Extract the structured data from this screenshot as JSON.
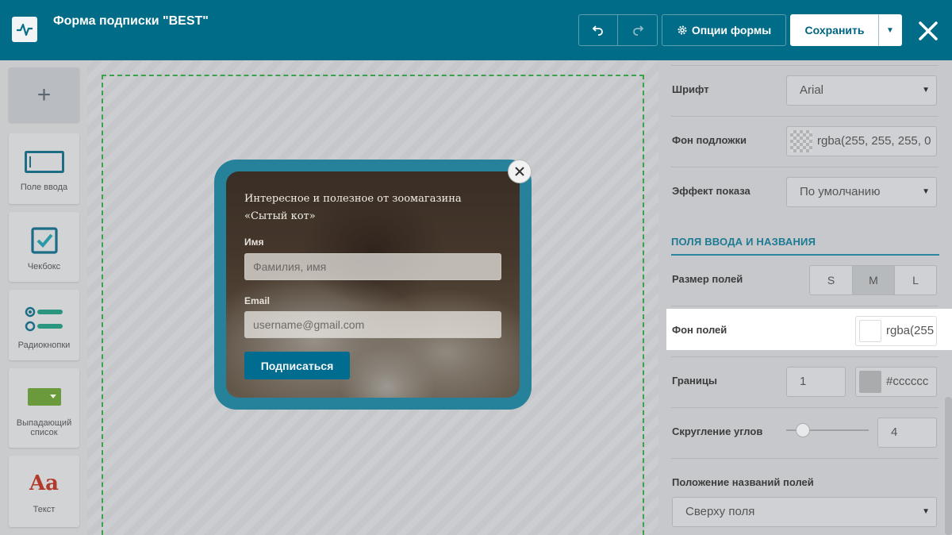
{
  "header": {
    "title": "Форма подписки \"BEST\"",
    "options_label": "Опции формы",
    "save_label": "Сохранить",
    "icons": [
      "logo-icon",
      "undo-icon",
      "redo-icon",
      "gear-icon",
      "caret-down-icon",
      "close-icon"
    ]
  },
  "toolbox": {
    "add_label": "+",
    "items": [
      {
        "label": "Поле ввода",
        "icon": "input-field-icon"
      },
      {
        "label": "Чекбокс",
        "icon": "checkbox-icon"
      },
      {
        "label": "Радиокнопки",
        "icon": "radio-buttons-icon"
      },
      {
        "label": "Выпадающий список",
        "icon": "dropdown-icon"
      },
      {
        "label": "Текст",
        "icon": "text-icon",
        "glyph": "Aa"
      }
    ]
  },
  "popup": {
    "heading": "Интересное и полезное от зоомагазина «Сытый кот»",
    "name_label": "Имя",
    "name_placeholder": "Фамилия, имя",
    "email_label": "Email",
    "email_placeholder": "username@gmail.com",
    "submit_label": "Подписаться",
    "border_color": "#26819b"
  },
  "panel": {
    "font_label": "Шрифт",
    "font_value": "Arial",
    "bg_label": "Фон подложки",
    "bg_value": "rgba(255, 255, 255, 0",
    "effect_label": "Эффект показа",
    "effect_value": "По умолчанию",
    "section_title": "ПОЛЯ ВВОДА И НАЗВАНИЯ",
    "size_label": "Размер полей",
    "sizes": [
      "S",
      "M",
      "L"
    ],
    "size_selected": "M",
    "fields_bg_label": "Фон полей",
    "fields_bg_value": "rgba(255",
    "borders_label": "Границы",
    "borders_width": "1",
    "borders_color": "#cccccc",
    "radius_label": "Скругление углов",
    "radius_value": "4",
    "radius_slider_level": 0.12,
    "label_pos_label": "Положение названий полей",
    "label_pos_value": "Сверху поля"
  },
  "colors": {
    "topbar": "#006c87",
    "accent": "#2c86a0",
    "drop_border": "#3aa24c",
    "submit": "#006c8f"
  }
}
